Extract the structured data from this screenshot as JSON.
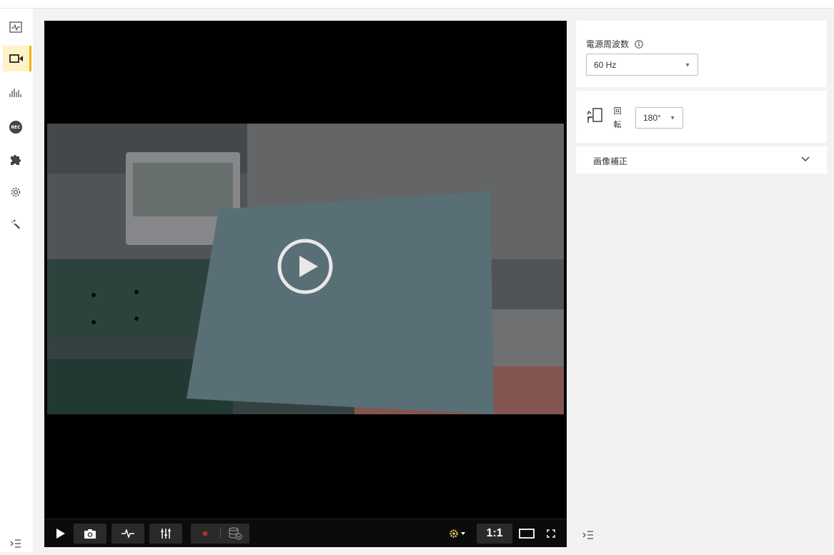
{
  "sidebar": {
    "items": [
      {
        "icon": "monitor-chart-icon"
      },
      {
        "icon": "video-camera-icon",
        "active": true
      },
      {
        "icon": "histogram-icon"
      },
      {
        "icon": "rec-icon",
        "label": "REC"
      },
      {
        "icon": "puzzle-icon"
      },
      {
        "icon": "gear-icon"
      },
      {
        "icon": "wrench-icon"
      }
    ],
    "collapse_icon": "collapse-menu-icon"
  },
  "video": {
    "status": "paused",
    "controls": {
      "play": "play-icon",
      "snapshot": "camera-icon",
      "pulse": "pulse-icon",
      "adjust": "sliders-icon",
      "record": "record-dot-icon",
      "storage": "database-download-icon",
      "settings": "gear-dropdown-icon",
      "ratio_label": "1:1",
      "screen": "screen-icon",
      "fullscreen": "fullscreen-icon"
    }
  },
  "settings": {
    "power_frequency": {
      "label": "電源周波数",
      "info_icon": "info-icon",
      "value": "60 Hz"
    },
    "rotation": {
      "icon": "rotate-icon",
      "label_top": "回",
      "label_bottom": "転",
      "value": "180°"
    },
    "image_correction": {
      "label": "画像補正",
      "expanded": false
    },
    "collapse_icon": "collapse-menu-icon"
  },
  "colors": {
    "accent": "#f2b200",
    "active_bg": "#fff2c6",
    "panel_bg": "#f2f2f2",
    "record_red": "#c0392b"
  }
}
